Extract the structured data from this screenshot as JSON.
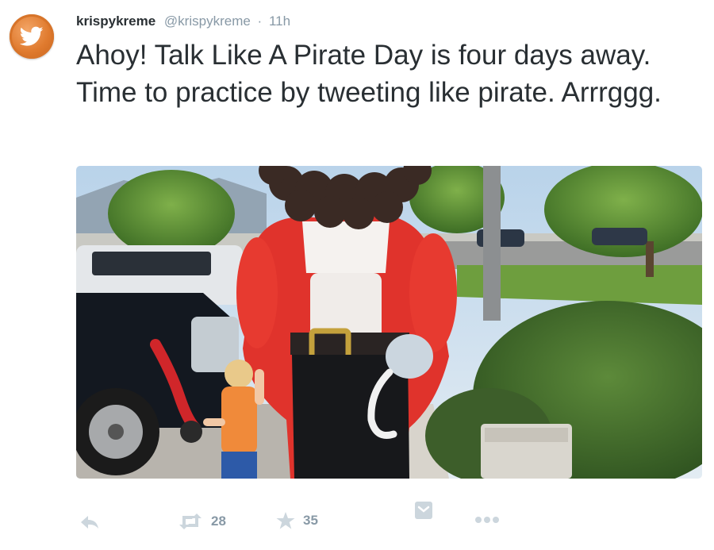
{
  "tweet": {
    "name": "krispykreme",
    "handle": "@krispykreme",
    "separator": "·",
    "time": "11h",
    "text": "Ahoy! Talk Like A Pirate Day is four days away. Time to practice by tweeting like pirate. Arrrggg.",
    "avatar_icon": "twitter-bird-icon",
    "avatar_color": "#e07b2f"
  },
  "photo": {
    "description_icon": "photo-image"
  },
  "actions": {
    "retweet_count": "28",
    "favorite_count": "35",
    "icons": [
      "reply-icon",
      "retweet-icon",
      "star-icon",
      "pocket-icon",
      "more-icon"
    ]
  },
  "colors": {
    "text": "#292f33",
    "muted": "#8899a6",
    "icon": "#ccd6dd"
  }
}
